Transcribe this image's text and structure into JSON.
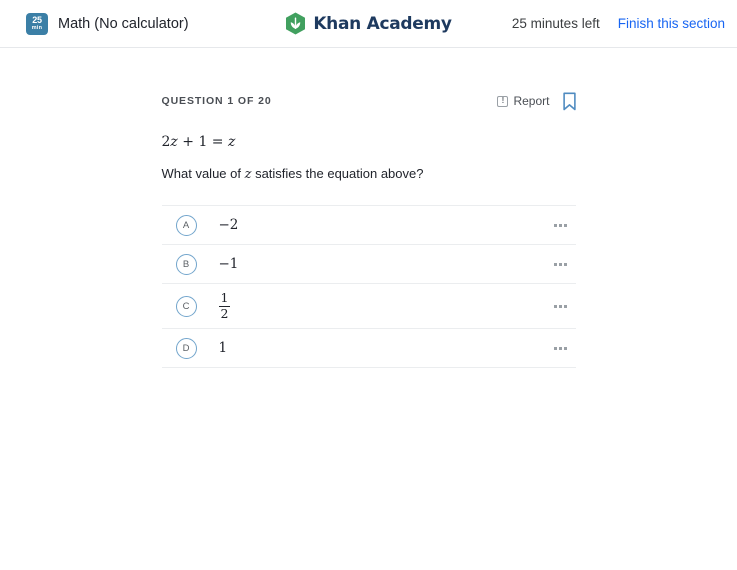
{
  "header": {
    "timer_badge": {
      "number": "25",
      "unit": "min",
      "color": "#3b7fa6"
    },
    "section_title": "Math (No calculator)",
    "brand": {
      "name": "Khan Academy",
      "logo_icon": "khan-academy-leaf-icon",
      "color": "#1e3a5f",
      "mark_color": "#41a05f"
    },
    "time_left": "25 minutes left",
    "finish_link": "Finish this section",
    "finish_link_color": "#1865f2"
  },
  "question": {
    "counter": "QUESTION 1 OF 20",
    "report_label": "Report",
    "report_icon": "exclamation-box-icon",
    "bookmark_icon": "bookmark-icon",
    "bookmark_color": "#4f8bc0",
    "equation": "2z + 1 = z",
    "equation_parts": {
      "coef": "2",
      "var1": "z",
      "plus": "+ 1 =",
      "var2": "z"
    },
    "prompt_before": "What value of ",
    "prompt_var": "z",
    "prompt_after": " satisfies the equation above?"
  },
  "choices": [
    {
      "letter": "A",
      "value": "−2",
      "type": "plain",
      "menu_icon": "ellipsis-icon"
    },
    {
      "letter": "B",
      "value": "−1",
      "type": "plain",
      "menu_icon": "ellipsis-icon"
    },
    {
      "letter": "C",
      "value": "1/2",
      "type": "fraction",
      "numerator": "1",
      "denominator": "2",
      "menu_icon": "ellipsis-icon"
    },
    {
      "letter": "D",
      "value": "1",
      "type": "plain",
      "menu_icon": "ellipsis-icon"
    }
  ]
}
